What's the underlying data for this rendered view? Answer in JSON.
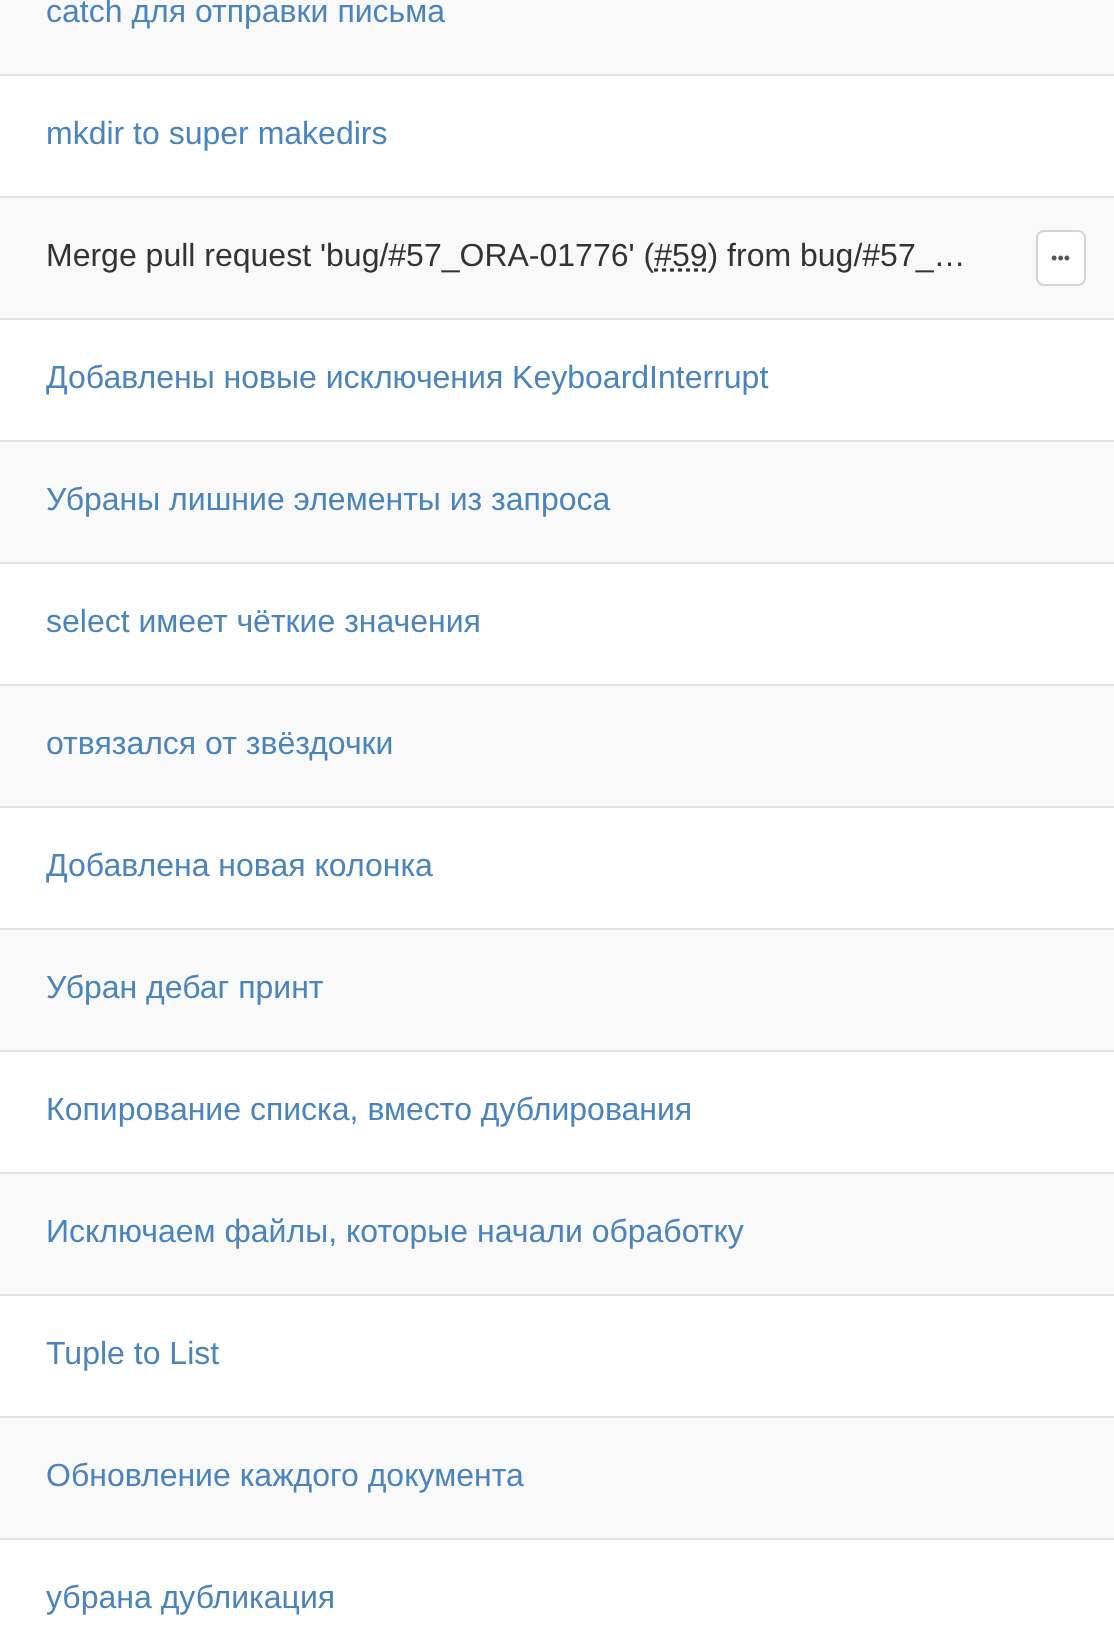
{
  "commits": [
    {
      "kind": "link",
      "message": "catch для отправки письма"
    },
    {
      "kind": "link",
      "message": "mkdir to super makedirs"
    },
    {
      "kind": "merge",
      "message_start": "Merge pull request 'bug/#57_ORA-01776' (",
      "issue": "#59",
      "message_end": ") from bug/#57_…",
      "more": "•••"
    },
    {
      "kind": "link",
      "message": "Добавлены новые исключения KeyboardInterrupt"
    },
    {
      "kind": "link",
      "message": "Убраны лишние элементы из запроса"
    },
    {
      "kind": "link",
      "message": "select имеет чёткие значения"
    },
    {
      "kind": "link",
      "message": "отвязался от звёздочки"
    },
    {
      "kind": "link",
      "message": "Добавлена новая колонка"
    },
    {
      "kind": "link",
      "message": "Убран дебаг принт"
    },
    {
      "kind": "link",
      "message": "Копирование списка, вместо дублирования"
    },
    {
      "kind": "link",
      "message": "Исключаем файлы, которые начали обработку"
    },
    {
      "kind": "link",
      "message": "Tuple to List"
    },
    {
      "kind": "link",
      "message": "Обновление каждого документа"
    },
    {
      "kind": "link",
      "message": "убрана дубликация"
    }
  ]
}
